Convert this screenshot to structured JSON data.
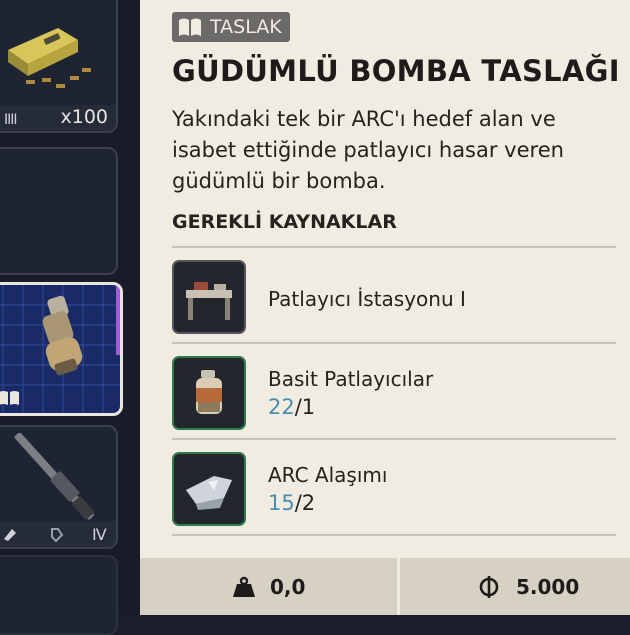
{
  "inventory": {
    "slot_ammo_qty": "x100",
    "slot_ammo_tier": "IIII",
    "slot_rifle_tier": "IV"
  },
  "detail": {
    "badge_label": "TASLAK",
    "title": "GÜDÜMLÜ BOMBA TASLAĞI",
    "description": "Yakındaki tek bir ARC'ı hedef alan ve isabet ettiğinde patlayıcı hasar veren güdümlü bir bomba.",
    "requirements_heading": "GEREKLİ KAYNAKLAR",
    "requirements": [
      {
        "name": "Patlayıcı İstasyonu I",
        "icon": "workbench-icon"
      },
      {
        "name": "Basit Patlayıcılar",
        "have": "22",
        "need": "/1",
        "icon": "explosives-icon"
      },
      {
        "name": "ARC Alaşımı",
        "have": "15",
        "need": "/2",
        "icon": "arc-alloy-icon"
      }
    ]
  },
  "footer": {
    "weight": "0,0",
    "price": "5.000"
  },
  "colors": {
    "panel_bg": "#f1ece2",
    "footer_bg": "#d7d1c4",
    "have_count": "#4a8dae",
    "owned_border": "#2f7a52",
    "selected_slot_accent": "#a35cd8"
  }
}
